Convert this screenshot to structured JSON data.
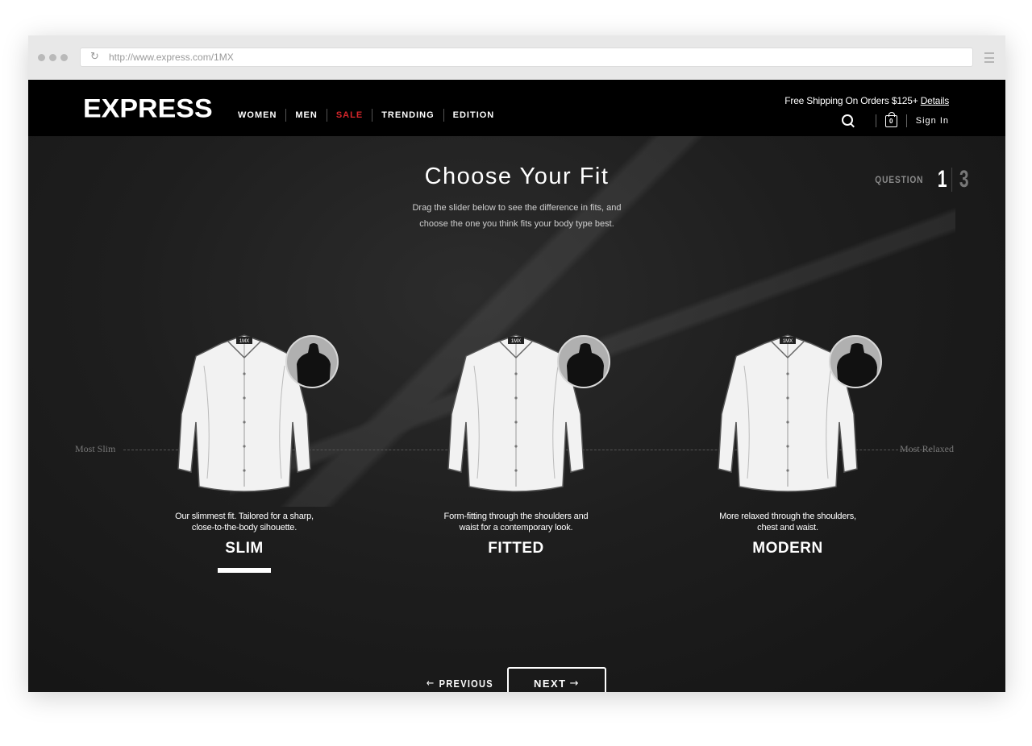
{
  "browser": {
    "url": "http://www.express.com/1MX"
  },
  "header": {
    "logo": "EXPRESS",
    "nav": [
      "WOMEN",
      "MEN",
      "SALE",
      "TRENDING",
      "EDITION"
    ],
    "shipping_text": "Free Shipping On Orders $125+",
    "shipping_link": "Details",
    "bag_count": "0",
    "sign_in": "Sign In"
  },
  "quiz": {
    "title": "Choose Your Fit",
    "subtitle_line1": "Drag the slider below to see the difference in fits, and",
    "subtitle_line2": "choose the one you think fits your body type best.",
    "question_label": "QUESTION",
    "question_current": "1",
    "question_total": "3",
    "slider_left": "Most Slim",
    "slider_right": "Most Relaxed",
    "selected_index": 0,
    "fits": [
      {
        "name": "SLIM",
        "desc_line1": "Our slimmest fit. Tailored for a sharp,",
        "desc_line2": "close-to-the-body sihouette.",
        "shirt_label": "1MX"
      },
      {
        "name": "FITTED",
        "desc_line1": "Form-fitting through the shoulders and",
        "desc_line2": "waist for a contemporary look.",
        "shirt_label": "1MX"
      },
      {
        "name": "MODERN",
        "desc_line1": "More relaxed through the shoulders,",
        "desc_line2": "chest and waist.",
        "shirt_label": "1MX"
      }
    ],
    "previous_label": "PREVIOUS",
    "next_label": "NEXT"
  },
  "colors": {
    "sale_red": "#d6262b",
    "header_bg": "#000000",
    "page_bg": "#1e1e1e"
  },
  "icons": [
    "reload-icon",
    "menu-icon",
    "search-icon",
    "bag-icon",
    "arrow-left-icon",
    "arrow-right-icon"
  ]
}
